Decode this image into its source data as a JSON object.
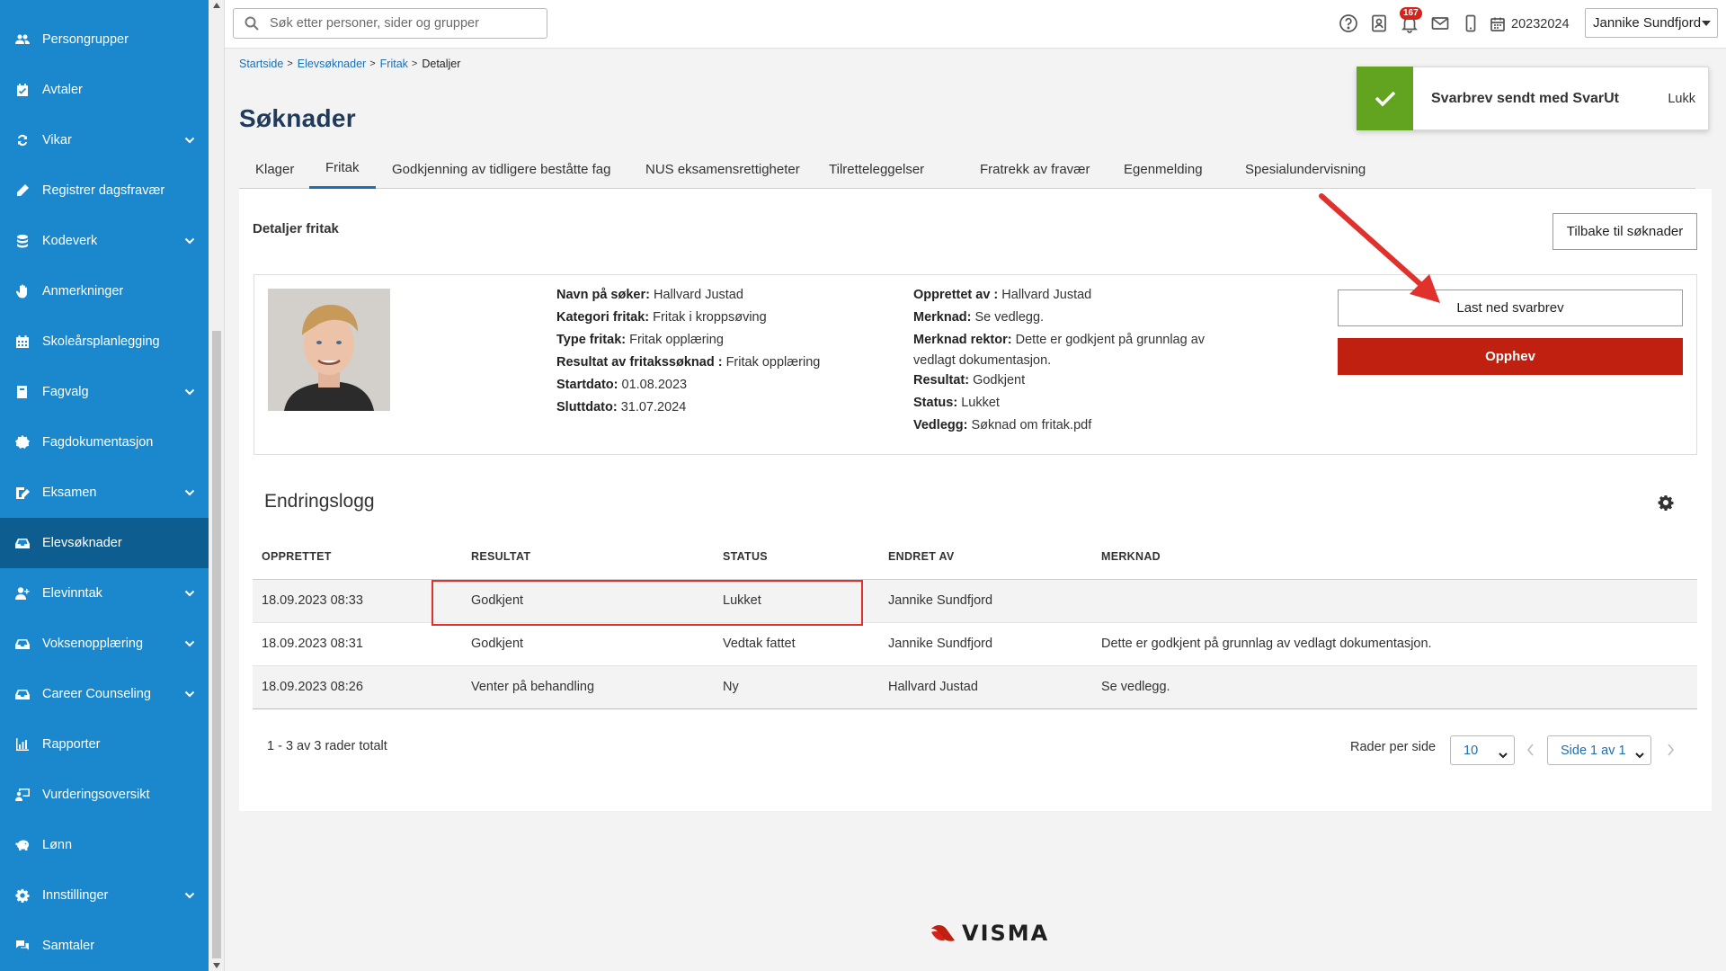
{
  "sidebar": {
    "items": [
      {
        "label": "Persongrupper",
        "icon": "people-icon",
        "has_children": false
      },
      {
        "label": "Avtaler",
        "icon": "calendar-check-icon",
        "has_children": false
      },
      {
        "label": "Vikar",
        "icon": "swap-icon",
        "has_children": true
      },
      {
        "label": "Registrer dagsfravær",
        "icon": "pencil-icon",
        "has_children": false
      },
      {
        "label": "Kodeverk",
        "icon": "database-icon",
        "has_children": true
      },
      {
        "label": "Anmerkninger",
        "icon": "hand-icon",
        "has_children": false
      },
      {
        "label": "Skoleårsplanlegging",
        "icon": "calendar-grid-icon",
        "has_children": false
      },
      {
        "label": "Fagvalg",
        "icon": "book-icon",
        "has_children": true
      },
      {
        "label": "Fagdokumentasjon",
        "icon": "badge-icon",
        "has_children": false
      },
      {
        "label": "Eksamen",
        "icon": "edit-doc-icon",
        "has_children": true
      },
      {
        "label": "Elevsøknader",
        "icon": "inbox-icon",
        "has_children": false,
        "active": true
      },
      {
        "label": "Elevinntak",
        "icon": "user-add-icon",
        "has_children": true
      },
      {
        "label": "Voksenopplæring",
        "icon": "inbox-icon",
        "has_children": true
      },
      {
        "label": "Career Counseling",
        "icon": "inbox-icon",
        "has_children": true
      },
      {
        "label": "Rapporter",
        "icon": "bar-chart-icon",
        "has_children": false
      },
      {
        "label": "Vurderingsoversikt",
        "icon": "user-screen-icon",
        "has_children": false
      },
      {
        "label": "Lønn",
        "icon": "piggy-bank-icon",
        "has_children": false
      },
      {
        "label": "Innstillinger",
        "icon": "gear-icon",
        "has_children": true
      },
      {
        "label": "Samtaler",
        "icon": "chat-icon",
        "has_children": false
      }
    ]
  },
  "topbar": {
    "search_placeholder": "Søk etter personer, sider og grupper",
    "notification_count": "167",
    "school_year": "20232024",
    "user_name": "Jannike Sundfjord"
  },
  "breadcrumb": {
    "items": [
      "Startside",
      "Elevsøknader",
      "Fritak"
    ],
    "current": "Detaljer"
  },
  "page_title": "Søknader",
  "tabs": [
    "Klager",
    "Fritak",
    "Godkjenning av tidligere beståtte fag",
    "NUS eksamensrettigheter",
    "Tilretteleggelser",
    "Fratrekk av fravær",
    "Egenmelding",
    "Spesialundervisning"
  ],
  "active_tab": "Fritak",
  "toast": {
    "message": "Svarbrev sendt med SvarUt",
    "close_label": "Lukk",
    "color": "#62a420"
  },
  "details": {
    "title": "Detaljer fritak",
    "back_label": "Tilbake til søknader",
    "left": [
      {
        "key": "Navn på søker:",
        "value": "Hallvard Justad"
      },
      {
        "key": "Kategori fritak:",
        "value": "Fritak i kroppsøving"
      },
      {
        "key": "Type fritak:",
        "value": "Fritak opplæring"
      },
      {
        "key": "Resultat av fritakssøknad :",
        "value": "Fritak opplæring"
      },
      {
        "key": "Startdato:",
        "value": "01.08.2023"
      },
      {
        "key": "Sluttdato:",
        "value": "31.07.2024"
      }
    ],
    "right": {
      "created_by_key": "Opprettet av :",
      "created_by": "Hallvard Justad",
      "note_key": "Merknad:",
      "note": "Se vedlegg.",
      "principal_note_key": "Merknad rektor:",
      "principal_note_1": "Dette er godkjent på grunnlag av",
      "principal_note_2": "vedlagt dokumentasjon.",
      "result_key": "Resultat:",
      "result": "Godkjent",
      "status_key": "Status:",
      "status": "Lukket",
      "attachment_key": "Vedlegg:",
      "attachment": "Søknad om fritak.pdf"
    },
    "download_label": "Last ned svarbrev",
    "revoke_label": "Opphev",
    "revoke_color": "#c0200f"
  },
  "log": {
    "title": "Endringslogg",
    "columns": [
      "OPPRETTET",
      "RESULTAT",
      "STATUS",
      "ENDRET AV",
      "MERKNAD"
    ],
    "rows": [
      [
        "18.09.2023 08:33",
        "Godkjent",
        "Lukket",
        "Jannike Sundfjord",
        ""
      ],
      [
        "18.09.2023 08:31",
        "Godkjent",
        "Vedtak fattet",
        "Jannike Sundfjord",
        "Dette er godkjent på grunnlag av vedlagt dokumentasjon."
      ],
      [
        "18.09.2023 08:26",
        "Venter på behandling",
        "Ny",
        "Hallvard Justad",
        "Se vedlegg."
      ]
    ],
    "total_text": "1 - 3 av 3 rader totalt",
    "rows_per_page_label": "Rader per side",
    "rows_per_page": "10",
    "page_text": "Side 1 av 1"
  },
  "footer": {
    "logo_text": "VISMA"
  }
}
